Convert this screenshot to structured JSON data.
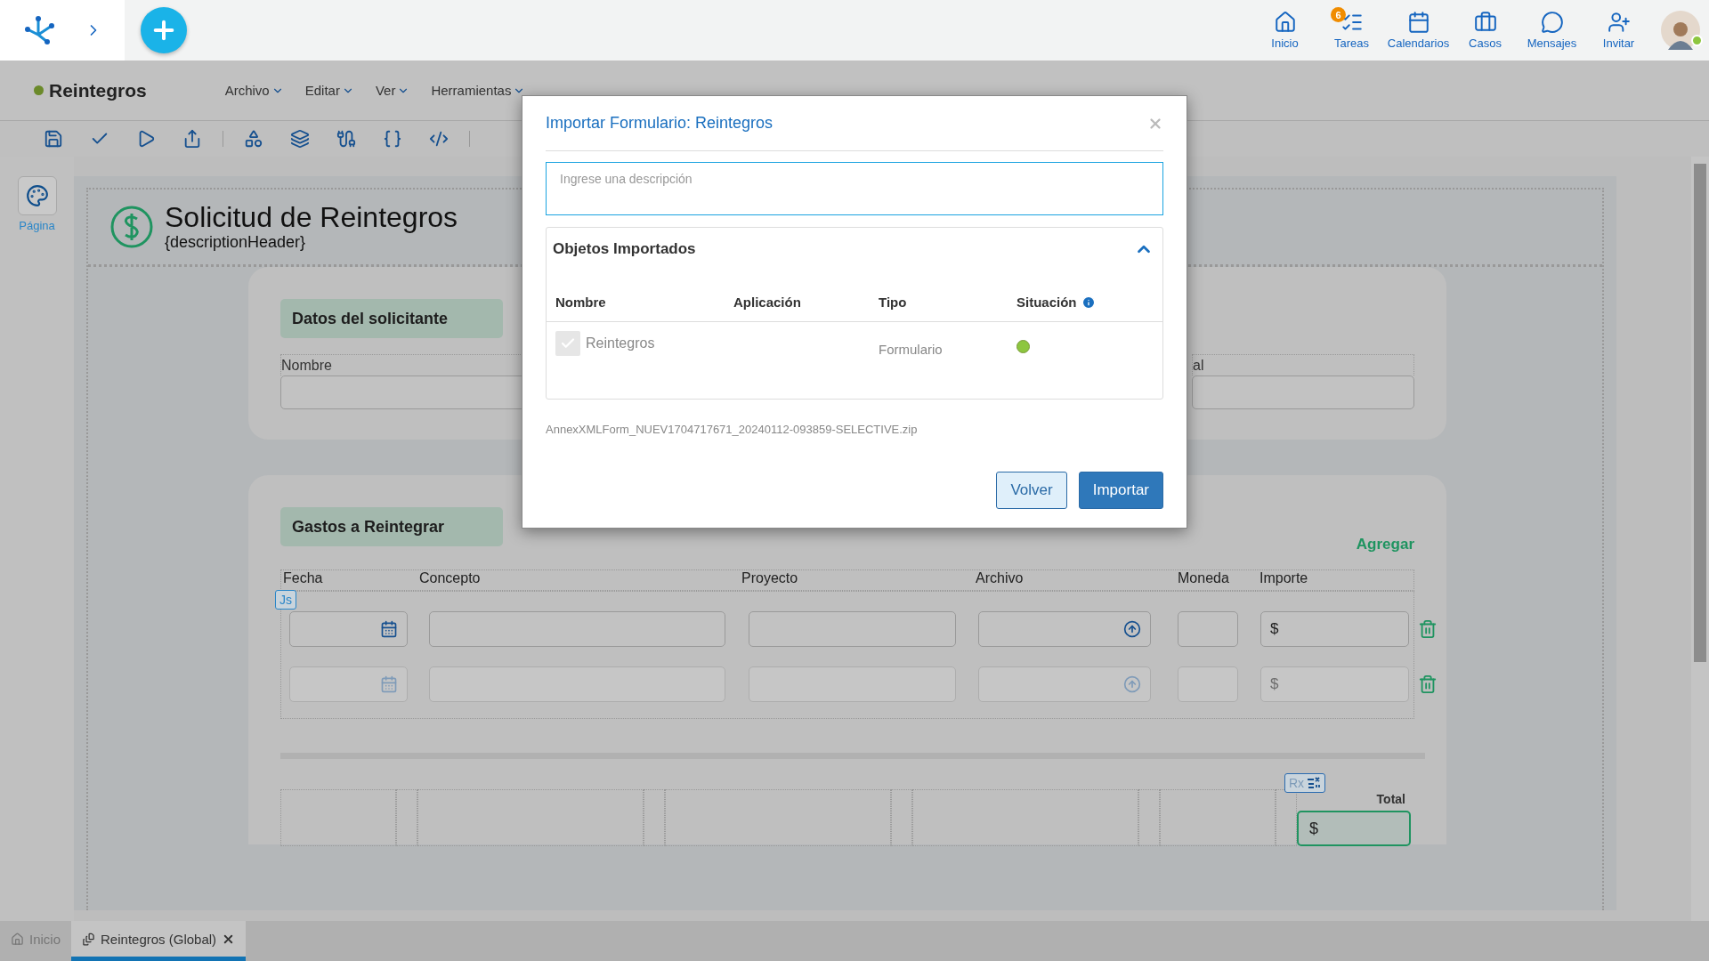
{
  "top_bar": {
    "nav": [
      {
        "label": "Inicio"
      },
      {
        "label": "Tareas",
        "badge": "6"
      },
      {
        "label": "Calendarios"
      },
      {
        "label": "Casos"
      },
      {
        "label": "Mensajes"
      },
      {
        "label": "Invitar"
      }
    ],
    "online": true
  },
  "document": {
    "title": "Reintegros",
    "menus": [
      "Archivo",
      "Editar",
      "Ver",
      "Herramientas"
    ]
  },
  "sidebar": {
    "label": "Página"
  },
  "form": {
    "title": "Solicitud de Reintegros",
    "subtitle": "{descriptionHeader}",
    "applicant": {
      "heading": "Datos del solicitante",
      "fields": [
        {
          "label": "Nombre"
        },
        {
          "label": "al"
        }
      ]
    },
    "expenses": {
      "heading": "Gastos a Reintegrar",
      "add_link": "Agregar",
      "js_badge": "Js",
      "columns": [
        "Fecha",
        "Concepto",
        "Proyecto",
        "Archivo",
        "Moneda",
        "Importe"
      ],
      "rows": [
        {
          "disabled": false,
          "amount": "$"
        },
        {
          "disabled": true,
          "amount": "$"
        }
      ],
      "total": {
        "label": "Total",
        "value": "$",
        "rx_badge": "Rx"
      }
    }
  },
  "modal": {
    "title": "Importar Formulario: Reintegros",
    "description": {
      "placeholder": "Ingrese una descripción"
    },
    "panel": {
      "title": "Objetos Importados",
      "expanded": true,
      "columns": [
        "Nombre",
        "Aplicación",
        "Tipo",
        "Situación"
      ],
      "rows": [
        {
          "checked": true,
          "name": "Reintegros",
          "type": "Formulario",
          "color": "#8dc63f"
        }
      ]
    },
    "file": "AnnexXMLForm_NUEV1704717671_20240112-093859-SELECTIVE.zip",
    "buttons": [
      {
        "label": "Volver",
        "kind": "secondary"
      },
      {
        "label": "Importar",
        "kind": "primary"
      }
    ]
  },
  "bottom_tabs": [
    {
      "label": "Inicio",
      "selected": false
    },
    {
      "label": "Reintegros (Global)",
      "selected": true
    }
  ]
}
